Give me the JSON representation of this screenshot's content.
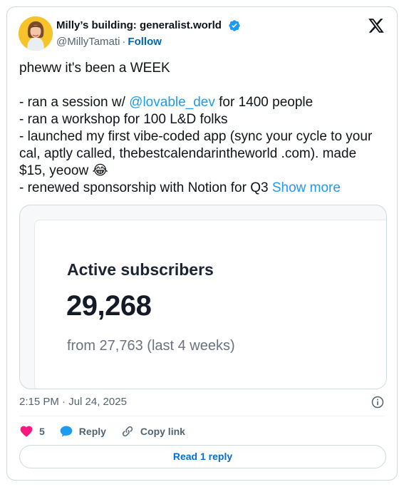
{
  "author": {
    "name": "Milly’s building: generalist.world",
    "handle": "@MillyTamati",
    "separator": "·",
    "follow_label": "Follow"
  },
  "tweet": {
    "line1": "pheww it's been a WEEK",
    "line2_prefix": "- ran a session w/ ",
    "mention": "@lovable_dev",
    "line2_suffix": " for 1400 people",
    "line3": "- ran a workshop for 100 L&D folks",
    "line4": "- launched my first vibe-coded app (sync your cycle to your cal, aptly called, thebestcalendarintheworld .com). made $15, yeoow 😂",
    "line5": "- renewed sponsorship with Notion for Q3",
    "show_more": "Show more"
  },
  "media": {
    "label": "Active subscribers",
    "value": "29,268",
    "sub": "from 27,763 (last 4 weeks)"
  },
  "timestamp": "2:15 PM · Jul 24, 2025",
  "actions": {
    "like_count": "5",
    "reply_label": "Reply",
    "copy_label": "Copy link"
  },
  "read_reply_label": "Read 1 reply",
  "colors": {
    "link": "#1d9bf0",
    "like": "#f91880",
    "reply_bubble": "#1d9bf0",
    "verified": "#1d9bf0"
  }
}
